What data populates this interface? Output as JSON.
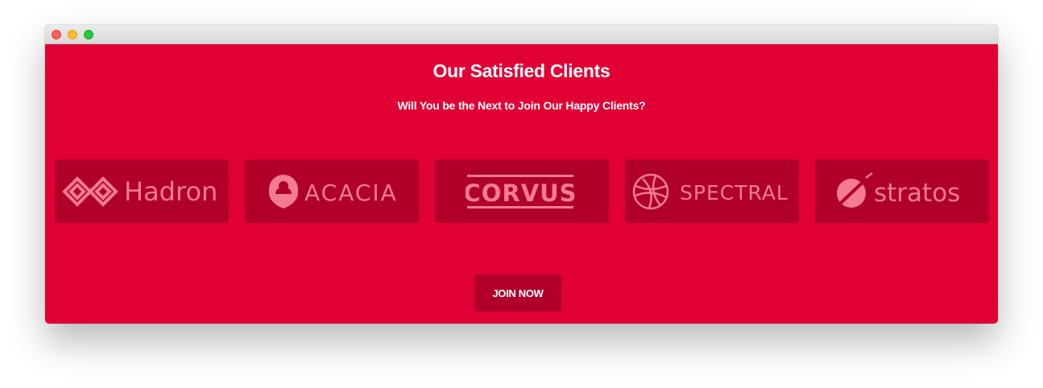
{
  "window": {
    "controls": [
      "close",
      "minimize",
      "zoom"
    ]
  },
  "section": {
    "title": "Our Satisfied Clients",
    "subtitle": "Will You be the Next to Join Our Happy Clients?"
  },
  "clients": [
    {
      "name": "Hadron",
      "icon": "hadron-logo-icon"
    },
    {
      "name": "ACACIA",
      "icon": "acacia-logo-icon"
    },
    {
      "name": "CORVUS",
      "icon": "corvus-logo-icon"
    },
    {
      "name": "SPECTRAL",
      "icon": "spectral-logo-icon"
    },
    {
      "name": "stratos",
      "icon": "stratos-logo-icon"
    }
  ],
  "cta": {
    "label": "JOIN NOW"
  },
  "colors": {
    "background": "#e10034",
    "tile": "#b0002a",
    "logo": "#f37b92",
    "text": "#ffffff"
  }
}
